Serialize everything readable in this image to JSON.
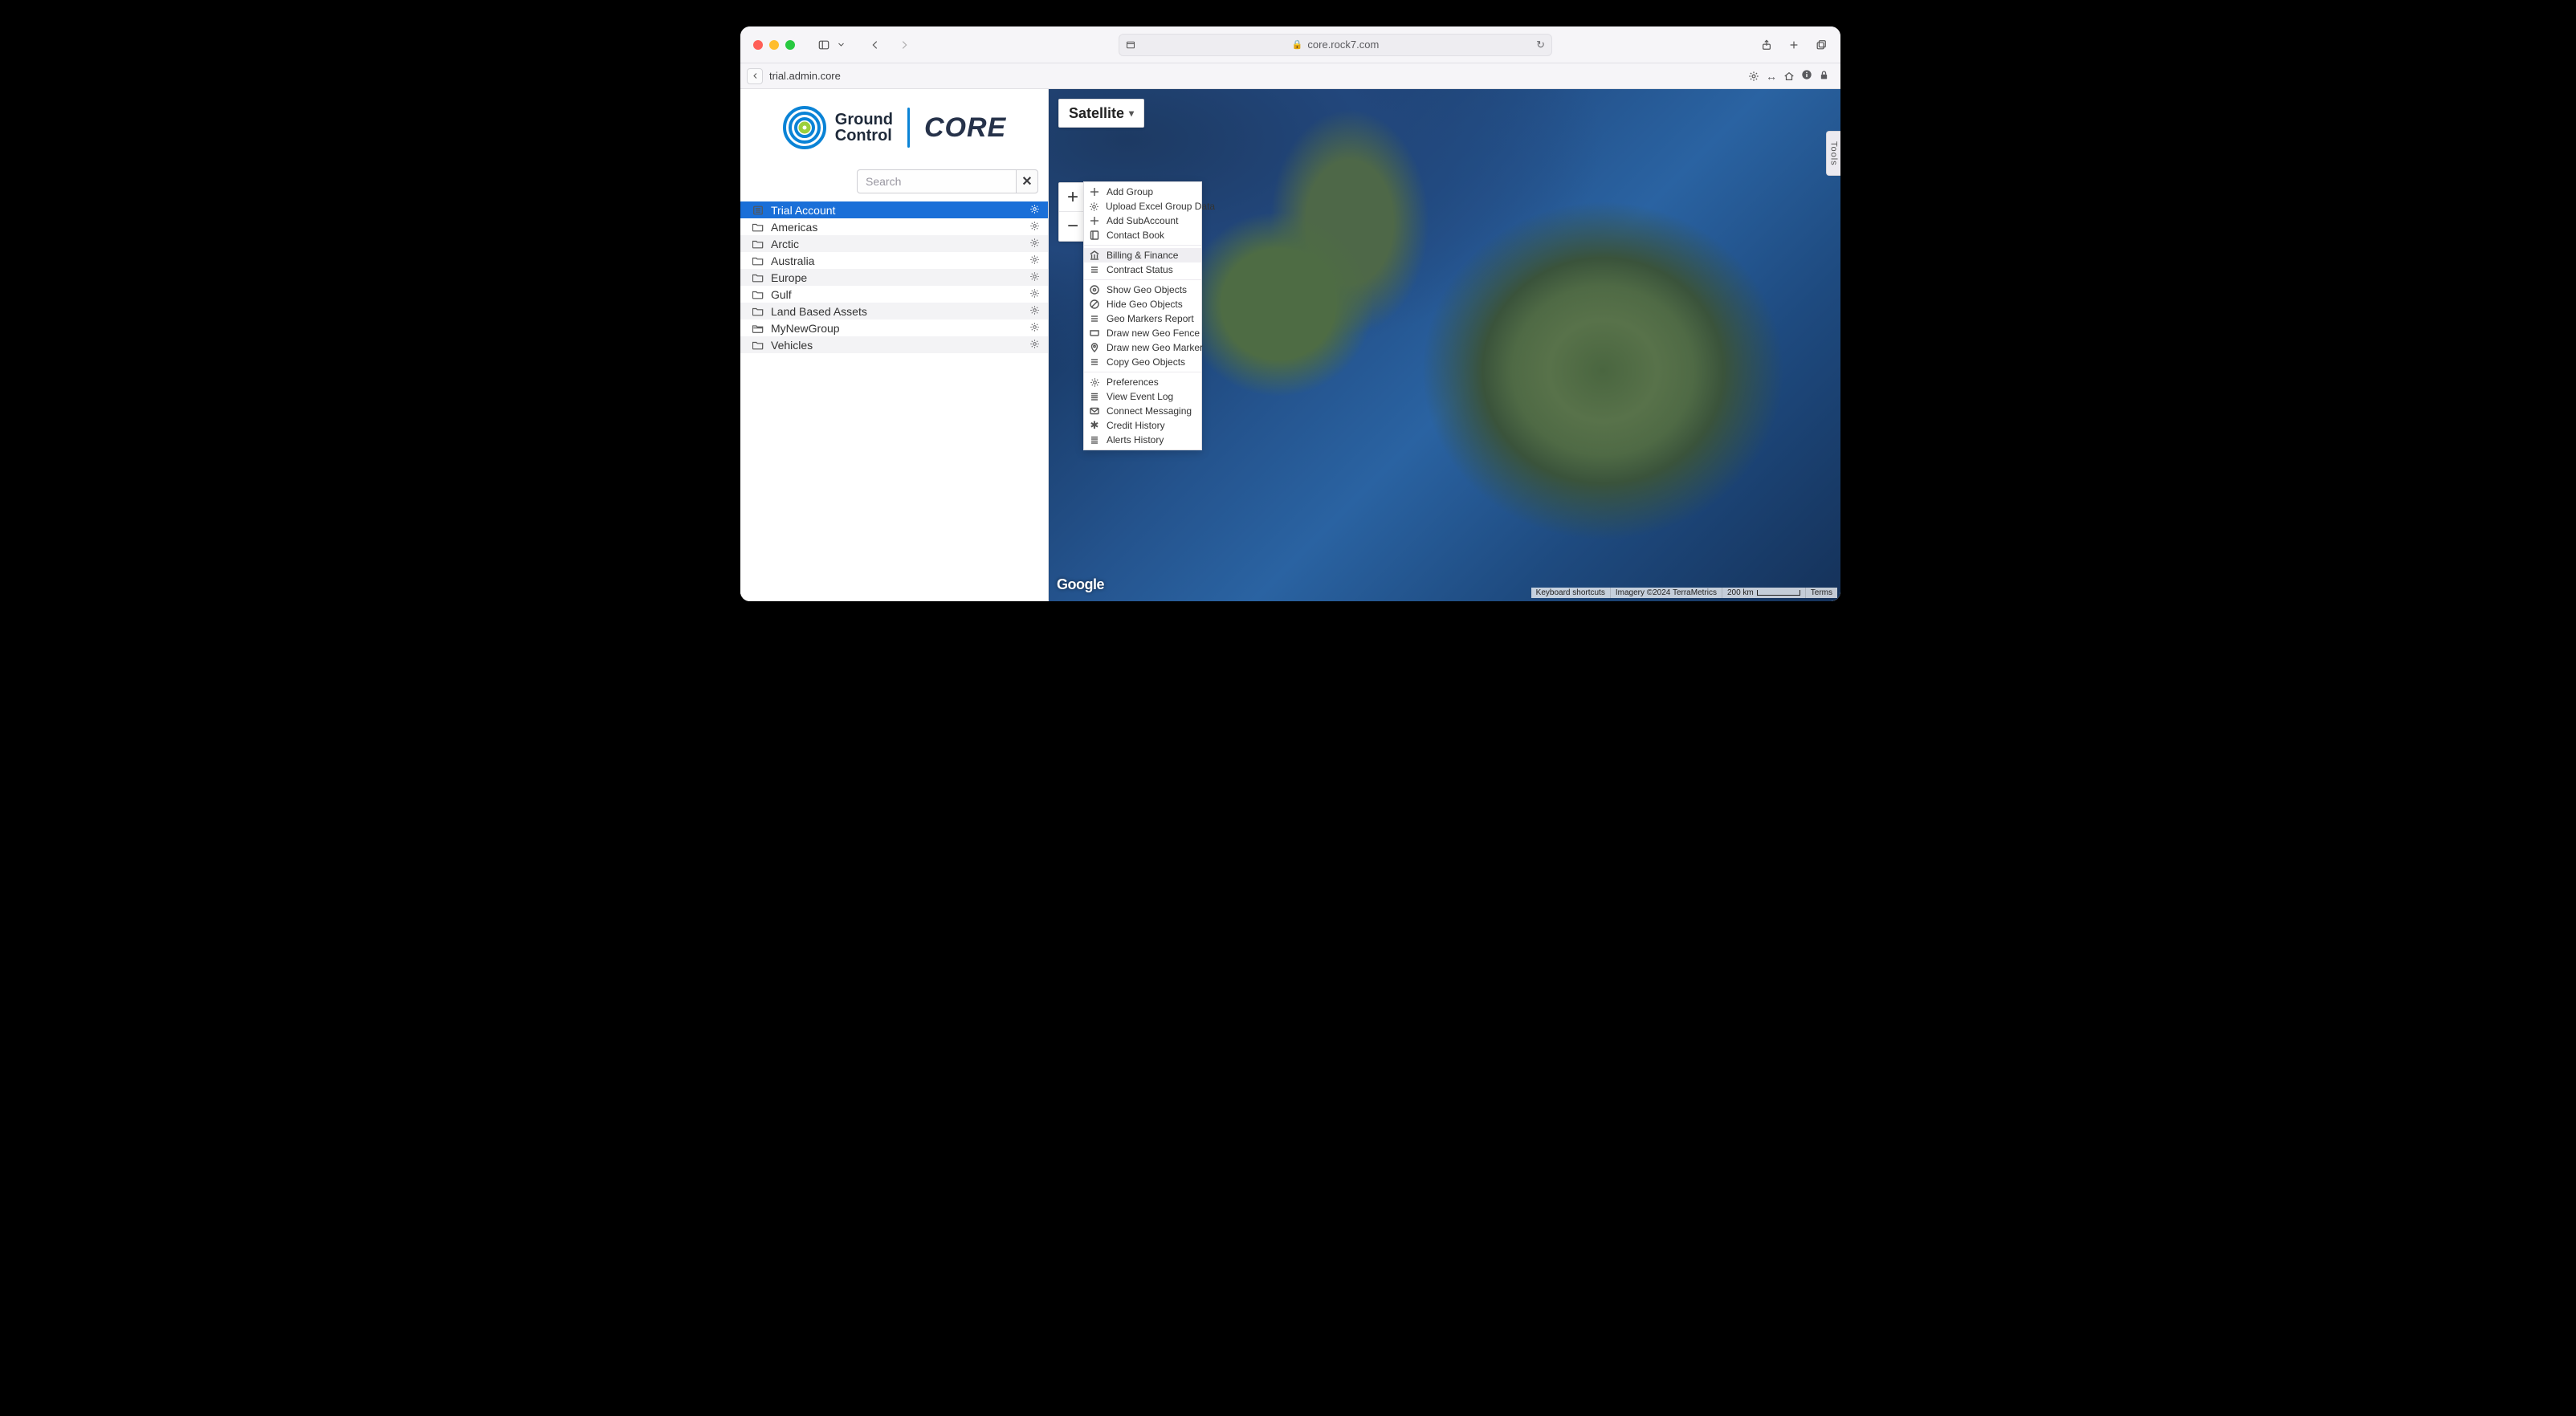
{
  "browser": {
    "url": "core.rock7.com",
    "tab_title": "trial.admin.core"
  },
  "logo": {
    "line1": "Ground",
    "line2": "Control",
    "brand": "CORE"
  },
  "search": {
    "placeholder": "Search",
    "value": ""
  },
  "tree": {
    "root_label": "Trial Account",
    "items": [
      {
        "label": "Americas"
      },
      {
        "label": "Arctic"
      },
      {
        "label": "Australia"
      },
      {
        "label": "Europe"
      },
      {
        "label": "Gulf"
      },
      {
        "label": "Land Based Assets"
      },
      {
        "label": "MyNewGroup"
      },
      {
        "label": "Vehicles"
      }
    ]
  },
  "map": {
    "type_label": "Satellite",
    "tools_label": "Tools",
    "google": "Google",
    "credits": {
      "shortcuts": "Keyboard shortcuts",
      "imagery": "Imagery ©2024 TerraMetrics",
      "scale": "200 km",
      "terms": "Terms"
    }
  },
  "menu": {
    "groups": [
      [
        {
          "icon": "plus",
          "label": "Add Group"
        },
        {
          "icon": "gear",
          "label": "Upload Excel Group Data"
        },
        {
          "icon": "plus",
          "label": "Add SubAccount"
        },
        {
          "icon": "book",
          "label": "Contact Book"
        }
      ],
      [
        {
          "icon": "bank",
          "label": "Billing & Finance",
          "hover": true
        },
        {
          "icon": "list",
          "label": "Contract Status"
        }
      ],
      [
        {
          "icon": "eye",
          "label": "Show Geo Objects"
        },
        {
          "icon": "noeye",
          "label": "Hide Geo Objects"
        },
        {
          "icon": "list",
          "label": "Geo Markers Report"
        },
        {
          "icon": "fence",
          "label": "Draw new Geo Fence"
        },
        {
          "icon": "marker",
          "label": "Draw new Geo Marker"
        },
        {
          "icon": "list",
          "label": "Copy Geo Objects"
        }
      ],
      [
        {
          "icon": "gear",
          "label": "Preferences"
        },
        {
          "icon": "lines",
          "label": "View Event Log"
        },
        {
          "icon": "mail",
          "label": "Connect Messaging"
        },
        {
          "icon": "star",
          "label": "Credit History"
        },
        {
          "icon": "lines",
          "label": "Alerts History"
        }
      ]
    ]
  }
}
